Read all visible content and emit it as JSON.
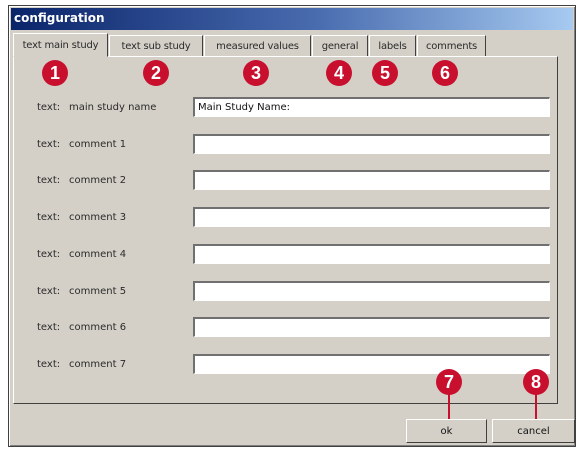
{
  "window": {
    "title": "configuration"
  },
  "tabs": [
    {
      "label": "text main study",
      "active": true
    },
    {
      "label": "text sub study",
      "active": false
    },
    {
      "label": "measured values",
      "active": false
    },
    {
      "label": "general",
      "active": false
    },
    {
      "label": "labels",
      "active": false
    },
    {
      "label": "comments",
      "active": false
    }
  ],
  "rows": [
    {
      "key": "text:",
      "label": "main study name",
      "value": "Main Study Name:"
    },
    {
      "key": "text:",
      "label": "comment 1",
      "value": ""
    },
    {
      "key": "text:",
      "label": "comment 2",
      "value": ""
    },
    {
      "key": "text:",
      "label": "comment 3",
      "value": ""
    },
    {
      "key": "text:",
      "label": "comment 4",
      "value": ""
    },
    {
      "key": "text:",
      "label": "comment 5",
      "value": ""
    },
    {
      "key": "text:",
      "label": "comment 6",
      "value": ""
    },
    {
      "key": "text:",
      "label": "comment 7",
      "value": ""
    }
  ],
  "buttons": {
    "ok": "ok",
    "cancel": "cancel"
  },
  "callouts": [
    "1",
    "2",
    "3",
    "4",
    "5",
    "6",
    "7",
    "8"
  ],
  "colors": {
    "callout": "#c8102e",
    "titlebar_start": "#0a246a",
    "dialog_face": "#d4d0c8"
  }
}
